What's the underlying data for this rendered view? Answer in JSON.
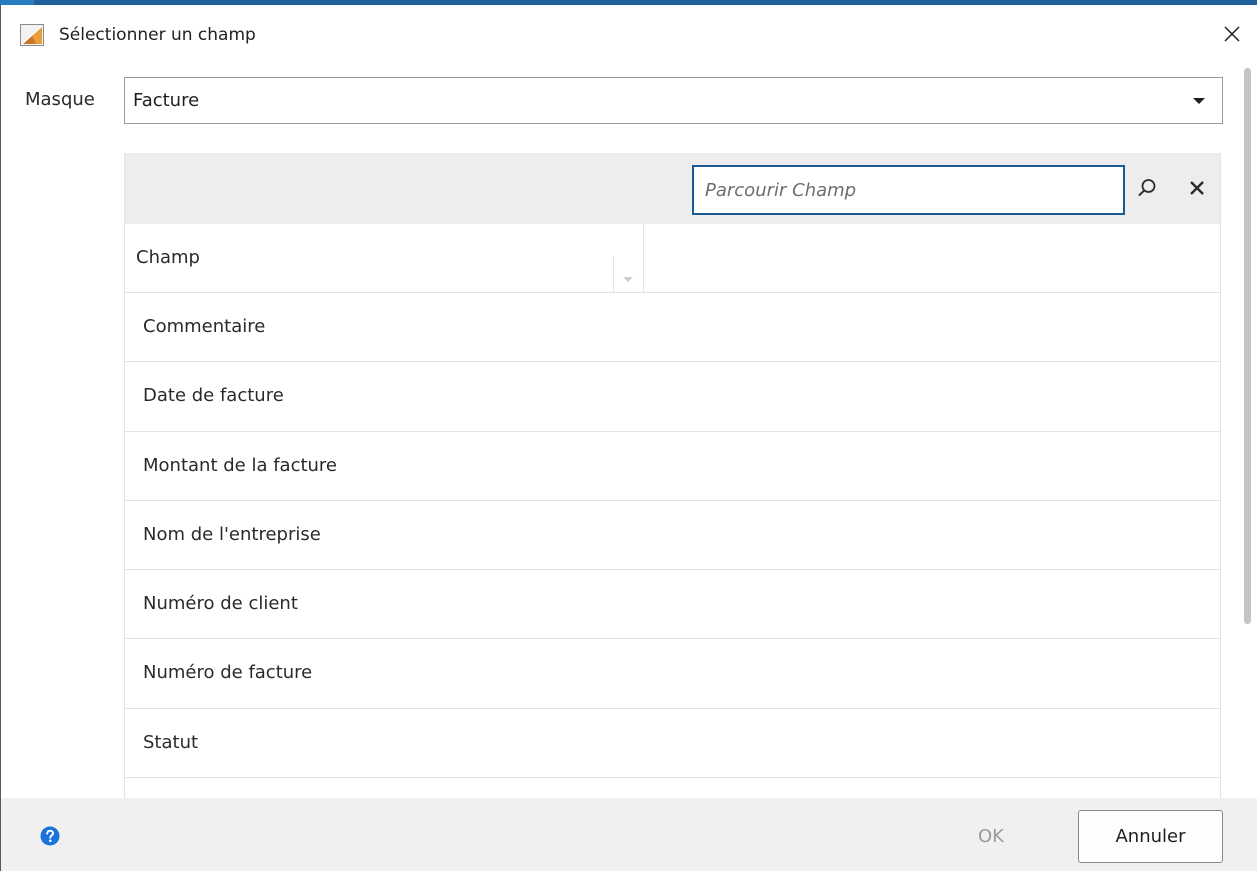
{
  "window": {
    "title": "Sélectionner un champ",
    "icons": {
      "app": "app-logo-icon",
      "close": "close-icon"
    }
  },
  "masque": {
    "label": "Masque",
    "selected": "Facture"
  },
  "grid": {
    "search_placeholder": "Parcourir Champ",
    "search_value": "",
    "column_header": "Champ",
    "rows": [
      "Commentaire",
      "Date de facture",
      "Montant de la facture",
      "Nom de l'entreprise",
      "Numéro de client",
      "Numéro de facture",
      "Statut",
      ""
    ]
  },
  "footer": {
    "ok_label": "OK",
    "cancel_label": "Annuler"
  },
  "colors": {
    "accent": "#1c5a95",
    "help_icon": "#1a73d9",
    "toolbar_bg": "#ededed",
    "footer_bg": "#f0f0f0",
    "disabled_text": "#9c9c9c"
  }
}
